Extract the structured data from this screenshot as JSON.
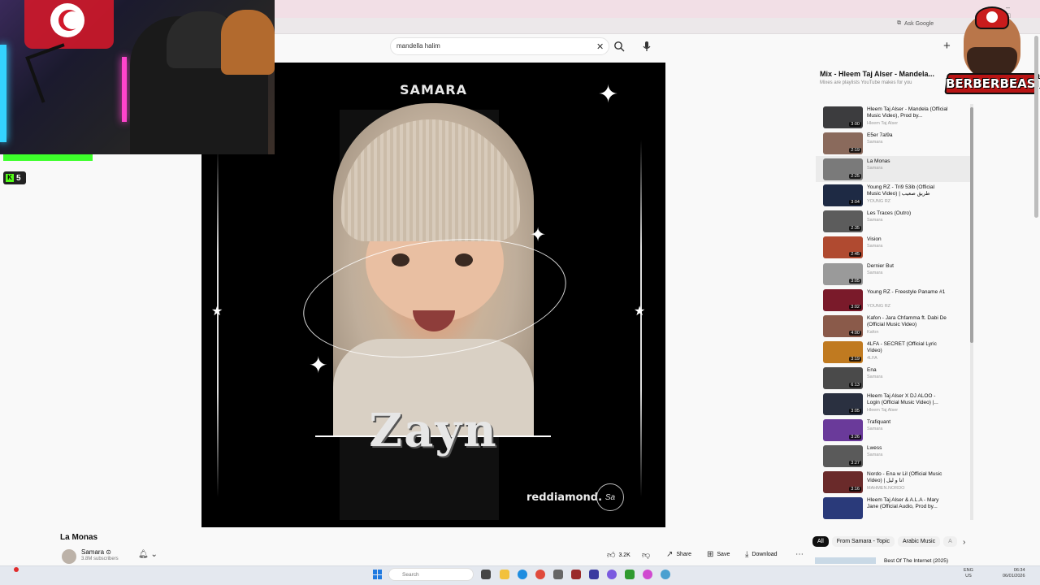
{
  "browser": {
    "ask_google": "Ask Google",
    "search_value": "mandella halim"
  },
  "overlay": {
    "kick_count": "5",
    "logo_text": "BERBERBEAST"
  },
  "video": {
    "art_brand": "SAMARA",
    "art_name": "Zayn",
    "art_label": "reddiamond.",
    "art_signature": "Sa",
    "title": "La Monas",
    "channel": "Samara",
    "subscribers": "3.8M subscribers",
    "likes": "3.2K",
    "share_label": "Share",
    "save_label": "Save",
    "download_label": "Download"
  },
  "mix": {
    "title": "Mix - Hleem Taj Alser - Mandela...",
    "subtitle": "Mixes are playlists YouTube makes for you",
    "items": [
      {
        "title": "Hleem Taj Alser - Mandela (Official Music Video), Prod by...",
        "channel": "Hleem Taj Alser",
        "duration": "3:00",
        "thumb": "#3c3c3e"
      },
      {
        "title": "E5er 7al9a",
        "channel": "Samara",
        "duration": "2:19",
        "thumb": "#8a6a5c"
      },
      {
        "title": "La Monas",
        "channel": "Samara",
        "duration": "2:25",
        "thumb": "#7a7a7a"
      },
      {
        "title": "Young RZ - Tri9 53ib (Official Music Video) | طريق صعيب",
        "channel": "YOUNG RZ",
        "duration": "3:04",
        "thumb": "#1e2a44"
      },
      {
        "title": "Les Traces (Outro)",
        "channel": "Samara",
        "duration": "2:35",
        "thumb": "#5c5c5c"
      },
      {
        "title": "Vision",
        "channel": "Samara",
        "duration": "2:45",
        "thumb": "#b04a30"
      },
      {
        "title": "Dernier But",
        "channel": "Samara",
        "duration": "3:05",
        "thumb": "#9a9a9a"
      },
      {
        "title": "Young RZ - Freestyle Paname #1",
        "channel": "YOUNG RZ",
        "duration": "3:02",
        "thumb": "#7a1a2a"
      },
      {
        "title": "Kafon - Jara Chfamma ft. Dabi De (Official Music Video)",
        "channel": "Kafon",
        "duration": "4:00",
        "thumb": "#8a5a4a"
      },
      {
        "title": "4LFA - SECRET (Official Lyric Video)",
        "channel": "4LFA",
        "duration": "3:19",
        "thumb": "#c07a20"
      },
      {
        "title": "Ena",
        "channel": "Samara",
        "duration": "6:13",
        "thumb": "#4a4a4a"
      },
      {
        "title": "Hleem Taj Alser X DJ ALOO - Login (Official Music Video) |...",
        "channel": "Hleem Taj Alser",
        "duration": "3:05",
        "thumb": "#2a3040"
      },
      {
        "title": "Trafiquant",
        "channel": "Samara",
        "duration": "3:26",
        "thumb": "#6a3a9a"
      },
      {
        "title": "Lwess",
        "channel": "Samara",
        "duration": "3:27",
        "thumb": "#5a5a5a"
      },
      {
        "title": "Nordo - Ena w Lil (Official Music Video) | انا و ليل",
        "channel": "MAHMEN.NORDO",
        "duration": "3:16",
        "thumb": "#6a2a2a"
      },
      {
        "title": "Hleem Taj Alser & A.L.A - Mary Jane (Official Audio, Prod by...",
        "channel": "",
        "duration": "",
        "thumb": "#2a3a7a"
      }
    ]
  },
  "chips": [
    "All",
    "From Samara - Topic",
    "Arabic Music",
    "A"
  ],
  "up_next": "Best Of The Internet (2025)",
  "taskbar": {
    "search_placeholder": "Search",
    "lang_1": "ENG",
    "lang_2": "US",
    "time": "06:34",
    "date": "06/01/2026"
  }
}
